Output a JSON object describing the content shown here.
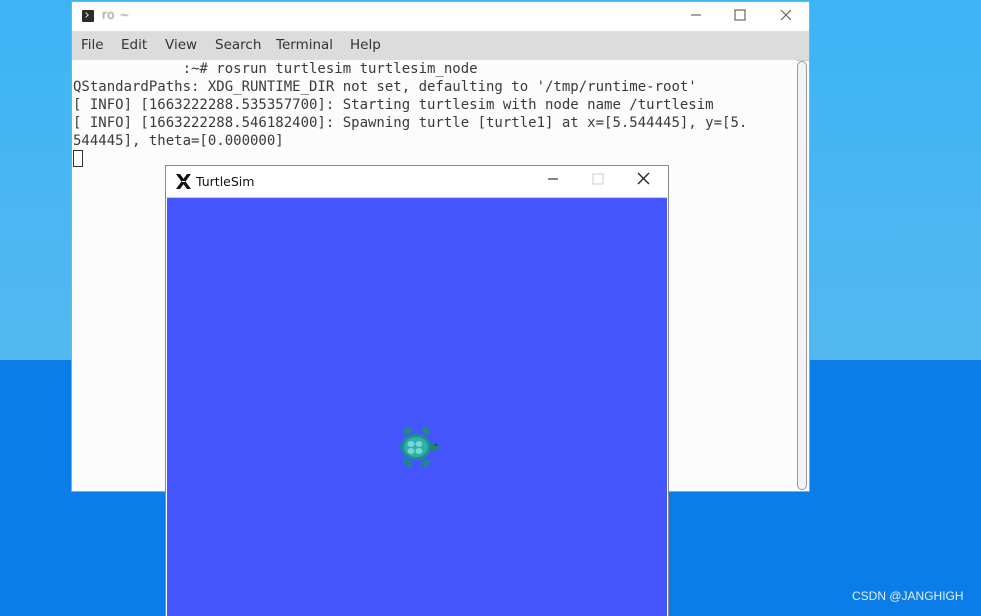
{
  "terminal": {
    "title": "ro  ~",
    "menu": [
      "File",
      "Edit",
      "View",
      "Search",
      "Terminal",
      "Help"
    ],
    "lines": [
      "             :~# rosrun turtlesim turtlesim_node",
      "QStandardPaths: XDG_RUNTIME_DIR not set, defaulting to '/tmp/runtime-root'",
      "[ INFO] [1663222288.535357700]: Starting turtlesim with node name /turtlesim",
      "[ INFO] [1663222288.546182400]: Spawning turtle [turtle1] at x=[5.544445], y=[5.",
      "544445], theta=[0.000000]"
    ]
  },
  "turtlesim": {
    "title": "TurtleSim",
    "background_color": "#4556ff"
  },
  "watermark": "CSDN @JANGHIGH",
  "icons": {
    "terminal": "terminal-icon",
    "minimize": "minimize-icon",
    "maximize": "maximize-icon",
    "close": "close-icon",
    "x11": "x11-logo-icon",
    "turtle": "turtle-icon"
  }
}
